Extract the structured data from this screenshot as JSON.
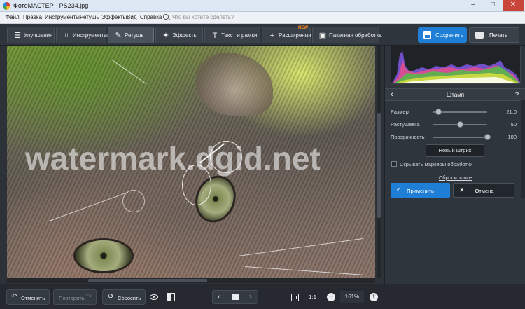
{
  "window": {
    "title": "ФотоМАСТЕР - PS234.jpg",
    "controls": {
      "minimize": "–",
      "maximize": "□",
      "close": "✕"
    }
  },
  "menu": {
    "items": [
      "Файл",
      "Правка",
      "Инструменты",
      "Ретушь",
      "Эффекты",
      "Вид",
      "Справка"
    ],
    "search_placeholder": "Что вы хотите сделать?"
  },
  "toolbar": {
    "tabs": [
      {
        "label": "Улучшения",
        "icon": "sliders-icon",
        "glyph": "☰"
      },
      {
        "label": "Инструменты",
        "icon": "crop-icon",
        "glyph": "⌗"
      },
      {
        "label": "Ретушь",
        "icon": "brush-icon",
        "glyph": "✎",
        "active": true
      },
      {
        "label": "Эффекты",
        "icon": "magic-wand-icon",
        "glyph": "✦"
      },
      {
        "label": "Текст и рамки",
        "icon": "text-icon",
        "glyph": "T"
      },
      {
        "label": "Расширения",
        "icon": "plus-icon",
        "glyph": "+",
        "badge": "NEW"
      },
      {
        "label": "Пакетная обработка",
        "icon": "batch-icon",
        "glyph": "▣"
      }
    ],
    "save_label": "Сохранить",
    "print_label": "Печать",
    "accent": "#1f7fd6"
  },
  "canvas": {
    "watermark_text": "watermark.dgid.net"
  },
  "panel": {
    "title": "Штамп",
    "back_glyph": "‹",
    "help_glyph": "?",
    "sliders": [
      {
        "label": "Размер",
        "value": "21,0",
        "fraction": 0.1
      },
      {
        "label": "Растушевка",
        "value": "50",
        "fraction": 0.5
      },
      {
        "label": "Прозрачность",
        "value": "100",
        "fraction": 1.0
      }
    ],
    "new_stroke_label": "Новый штрих",
    "hide_markers_label": "Скрывать маркеры обработки",
    "reset_all_label": "Сбросить все",
    "apply_label": "Применить",
    "apply_glyph": "✓",
    "cancel_label": "Отмена",
    "cancel_glyph": "✕"
  },
  "bottom": {
    "undo_label": "Отменить",
    "undo_glyph": "↶",
    "redo_label": "Повторить",
    "redo_glyph": "↷",
    "reset_label": "Сбросить",
    "reset_glyph": "↺",
    "prev_glyph": "‹",
    "next_glyph": "›",
    "zoom_ratio_label": "1:1",
    "zoom_out_glyph": "−",
    "zoom_in_glyph": "+",
    "zoom_value": "161%"
  }
}
